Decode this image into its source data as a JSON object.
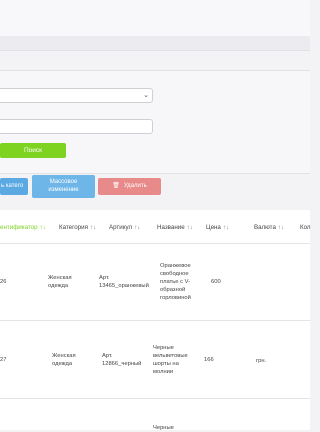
{
  "filters": {
    "search_label": "Поиск"
  },
  "actions": {
    "category_label": "ь катего",
    "mass_label_line1": "Массовое",
    "mass_label_line2": "изменение",
    "delete_label": "Удалить"
  },
  "table": {
    "headers": {
      "id": "Идентификатор",
      "category": "Категория",
      "article": "Артикул",
      "name": "Название",
      "price": "Цена",
      "currency": "Валюта",
      "qty": "Кол"
    },
    "sort_icon": "↑↓",
    "rows": [
      {
        "id": "26",
        "category_1": "Женская",
        "category_2": "одежда",
        "article_1": "Арт.",
        "article_2": "13465_оранжевый",
        "name_1": "Оранжевое",
        "name_2": "свободное",
        "name_3": "платье с V-",
        "name_4": "образной",
        "name_5": "горловиной",
        "price": "600",
        "currency": ""
      },
      {
        "id": "27",
        "category_1": "Женская",
        "category_2": "одежда",
        "article_1": "Арт.",
        "article_2": "12866_черный",
        "name_1": "Черные",
        "name_2": "вельветовые",
        "name_3": "шорты на",
        "name_4": "молнии",
        "name_5": "",
        "price": "166",
        "currency": "грн."
      },
      {
        "name_1": "Черные"
      }
    ]
  }
}
